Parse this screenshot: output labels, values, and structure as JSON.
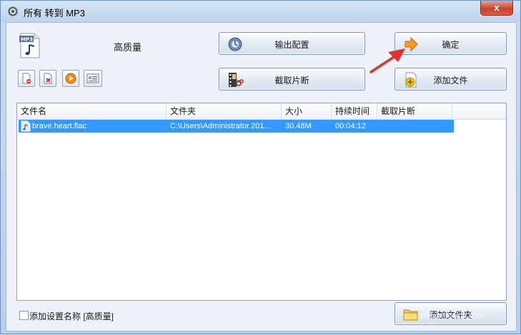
{
  "window": {
    "title": "所有 转到 MP3",
    "close_label": "x"
  },
  "preset": {
    "label": "高质量",
    "icon_text": "MP3"
  },
  "buttons": {
    "output_config": "输出配置",
    "ok": "确定",
    "clip": "截取片断",
    "add_file": "添加文件",
    "add_folder": "添加文件夹"
  },
  "toolbar_icons": [
    "remove-file-icon",
    "clear-list-icon",
    "play-icon",
    "info-icon"
  ],
  "list": {
    "columns": [
      "文件名",
      "文件夹",
      "大小",
      "持续时间",
      "截取片断"
    ],
    "rows": [
      {
        "name": "brave.heart.flac",
        "folder": "C:\\Users\\Administrator.201...",
        "size": "30.48M",
        "duration": "00:04:12",
        "clip": ""
      }
    ]
  },
  "options": {
    "add_setting_name": "添加设置名称 [高质量]"
  },
  "watermark": {
    "text": "Baidu 经验",
    "sub": "jingyan.baidu.com"
  },
  "colors": {
    "selection": "#3399ff",
    "arrow": "#e0312b"
  }
}
